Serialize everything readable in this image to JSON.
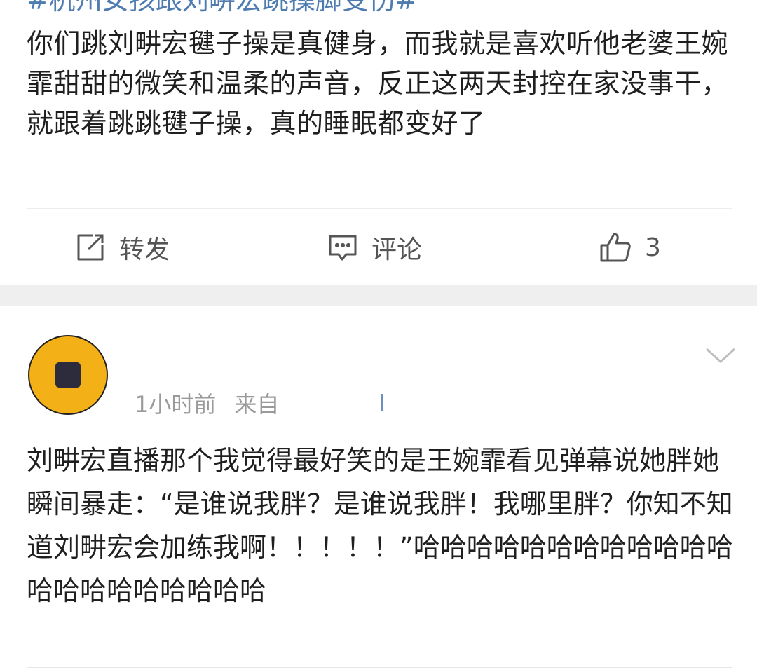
{
  "post": {
    "hashtag": "#杭州女孩跟刘畊宏跳操脚受伤#",
    "body": "你们跳刘畊宏毽子操是真健身，而我就是喜欢听他老婆王婉霏甜甜的微笑和温柔的声音，反正这两天封控在家没事干，就跟着跳跳毽子操，真的睡眠都变好了"
  },
  "actions": {
    "repost_label": "转发",
    "comment_label": "评论",
    "like_count": "3"
  },
  "comment": {
    "time": "1小时前",
    "source": "来自",
    "body": "刘畊宏直播那个我觉得最好笑的是王婉霏看见弹幕说她胖她瞬间暴走：“是谁说我胖？是谁说我胖！我哪里胖？你知不知道刘畊宏会加练我啊！！！！！”哈哈哈哈哈哈哈哈哈哈哈哈哈哈哈哈哈哈哈哈哈",
    "avatar_color": "#f4b117"
  },
  "colors": {
    "hashtag": "#4f7cb0",
    "text": "#1f1f1f",
    "muted": "#9a9a9a",
    "icon": "#555555"
  },
  "icons": {
    "repost": "repost-icon",
    "comment": "comment-icon",
    "like": "thumbs-up-icon",
    "more": "chevron-down-icon"
  }
}
